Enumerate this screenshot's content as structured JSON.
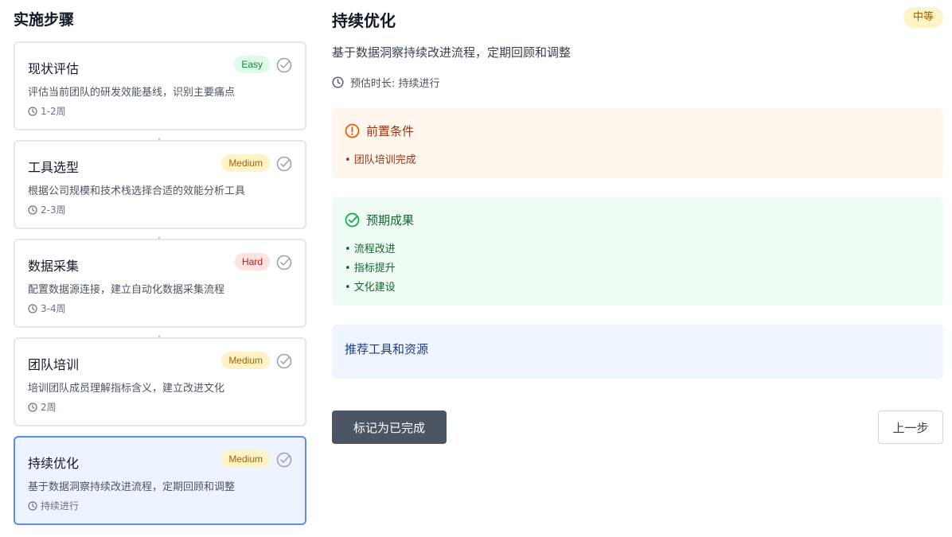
{
  "sidebar": {
    "title": "实施步骤",
    "steps": [
      {
        "title": "现状评估",
        "difficulty": "Easy",
        "description": "评估当前团队的研发效能基线，识别主要痛点",
        "duration": "1-2周"
      },
      {
        "title": "工具选型",
        "difficulty": "Medium",
        "description": "根据公司规模和技术栈选择合适的效能分析工具",
        "duration": "2-3周"
      },
      {
        "title": "数据采集",
        "difficulty": "Hard",
        "description": "配置数据源连接，建立自动化数据采集流程",
        "duration": "3-4周"
      },
      {
        "title": "团队培训",
        "difficulty": "Medium",
        "description": "培训团队成员理解指标含义，建立改进文化",
        "duration": "2周"
      },
      {
        "title": "持续优化",
        "difficulty": "Medium",
        "description": "基于数据洞察持续改进流程，定期回顾和调整",
        "duration": "持续进行",
        "active": true
      }
    ]
  },
  "detail": {
    "title": "持续优化",
    "level": "中等",
    "description": "基于数据洞察持续改进流程，定期回顾和调整",
    "duration_label": "预估时长: 持续进行",
    "prerequisites": {
      "heading": "前置条件",
      "items": [
        "• 团队培训完成"
      ]
    },
    "outcomes": {
      "heading": "预期成果",
      "items": [
        "• 流程改进",
        "• 指标提升",
        "• 文化建设"
      ]
    },
    "resources": {
      "heading": "推荐工具和资源"
    },
    "buttons": {
      "complete": "标记为已完成",
      "previous": "上一步"
    }
  },
  "icons": {
    "check": "check-circle-icon",
    "clock": "clock-icon",
    "arrow": "arrow-down-icon",
    "alert": "alert-circle-icon"
  },
  "colors": {
    "active_border": "#5b8def",
    "active_bg": "#eef4ff",
    "prereq_bg": "#fff6ed",
    "outcome_bg": "#effcf3",
    "resource_bg": "#eff5ff",
    "primary_button": "#4b5563"
  }
}
